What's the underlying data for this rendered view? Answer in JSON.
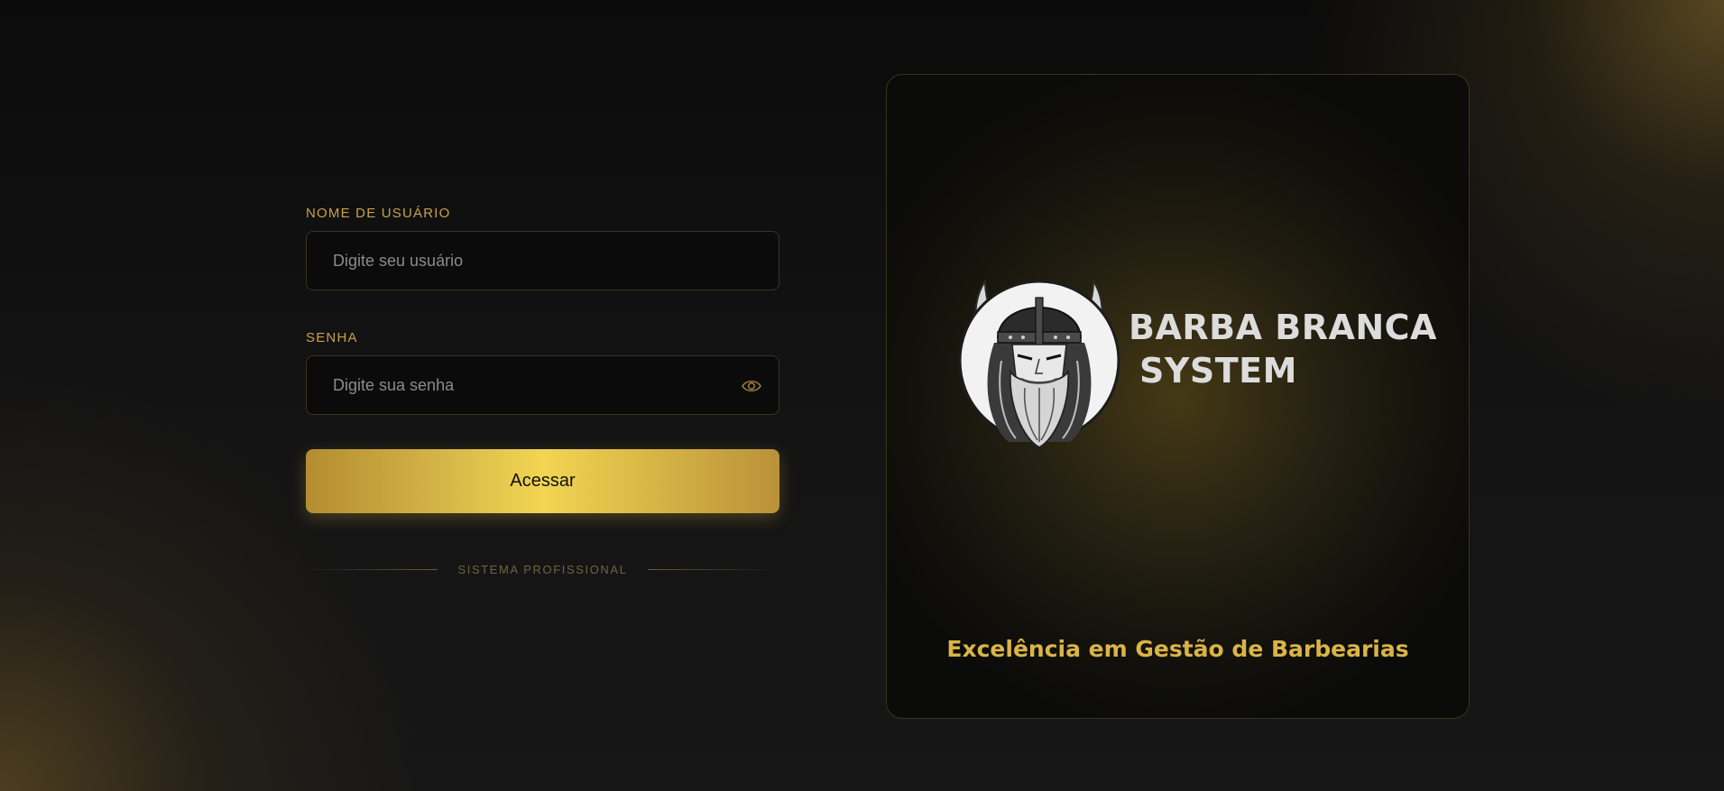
{
  "login": {
    "username_label": "NOME DE USUÁRIO",
    "username_placeholder": "Digite seu usuário",
    "username_value": "",
    "password_label": "SENHA",
    "password_placeholder": "Digite sua senha",
    "password_value": "",
    "show_password_icon": "eye-icon",
    "submit_label": "Acessar",
    "divider_text": "SISTEMA PROFISSIONAL"
  },
  "brand": {
    "name_line1": "BARBA BRANCA",
    "name_line2": "SYSTEM",
    "logo": "viking-logo",
    "tagline": "Excelência em Gestão de Barbearias"
  },
  "colors": {
    "accent_gold": "#d9b546",
    "label_gold": "#caa14a",
    "background": "#141414"
  }
}
